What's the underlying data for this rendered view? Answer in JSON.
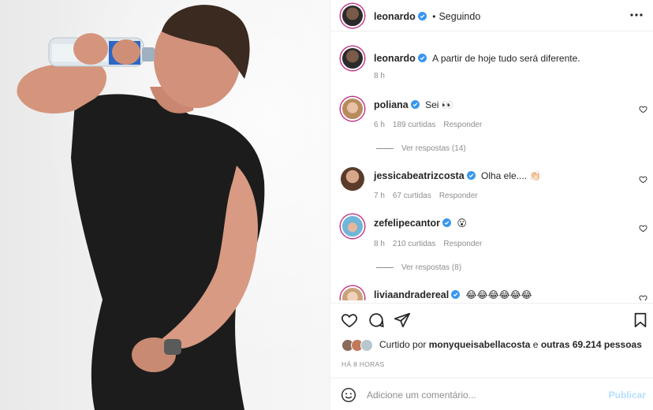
{
  "post": {
    "author": "leonardo",
    "follow_status": "Seguindo",
    "caption": "A partir de hoje tudo será diferente.",
    "caption_time": "8 h"
  },
  "comments": [
    {
      "user": "poliana",
      "text": "Sei 👀",
      "time": "6 h",
      "likes": "189 curtidas",
      "reply": "Responder",
      "view_replies": "Ver respostas (14)"
    },
    {
      "user": "jessicabeatrizcosta",
      "text": "Olha ele.... 👏🏻",
      "time": "7 h",
      "likes": "67 curtidas",
      "reply": "Responder"
    },
    {
      "user": "zefelipecantor",
      "text": "😮",
      "time": "8 h",
      "likes": "210 curtidas",
      "reply": "Responder",
      "view_replies": "Ver respostas (8)"
    },
    {
      "user": "liviaandradereal",
      "text": "😂😂😂😂😂😂"
    }
  ],
  "likes_summary": {
    "prefix": "Curtido por",
    "user": "monyqueisabellacosta",
    "middle": "e",
    "others": "outras 69.214 pessoas"
  },
  "time_ago": "HÁ 8 HORAS",
  "add_comment": {
    "placeholder": "Adicione um comentário...",
    "publish": "Publicar"
  },
  "icons": {
    "verified": "verified-badge-icon",
    "more": "more-options-icon",
    "like": "heart-icon",
    "comment": "comment-icon",
    "share": "paper-plane-icon",
    "save": "bookmark-icon",
    "emoji": "smiley-icon"
  },
  "colors": {
    "verified_blue": "#3897f0",
    "muted_text": "#8e8e8e",
    "publish_disabled": "#b2dffc"
  }
}
